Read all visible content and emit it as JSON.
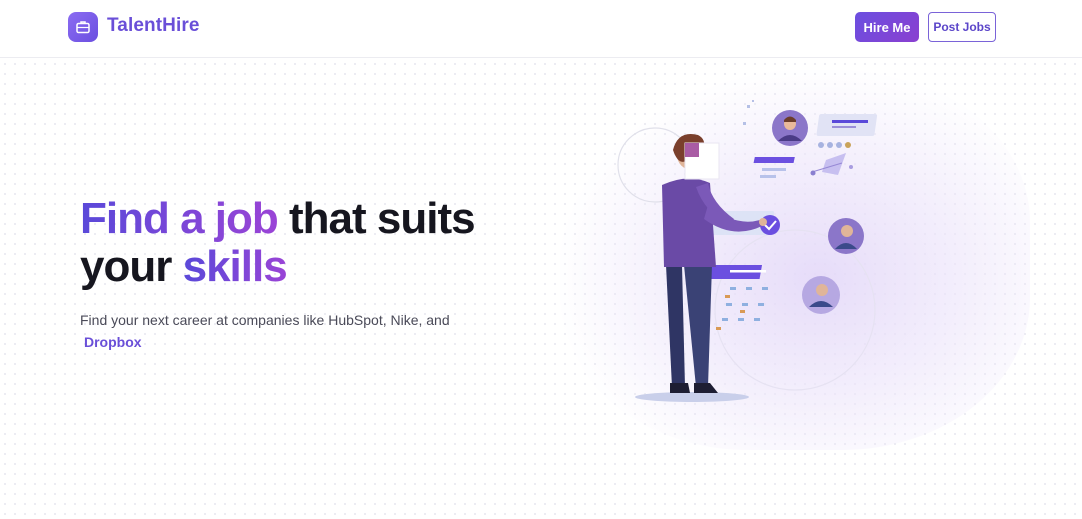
{
  "header": {
    "brand_name": "TalentHire",
    "logo_icon": "briefcase-icon",
    "hire_button_label": "Hire Me",
    "post_button_label": "Post Jobs"
  },
  "hero": {
    "headline": {
      "part1": "Find a job",
      "part2": "that suits",
      "part3": "your",
      "part4": "skills"
    },
    "subtext": "Find your next career at companies like HubSpot, Nike, and",
    "subtext_link": "Dropbox",
    "illustration": "person-selecting-candidate-profiles-illustration"
  },
  "colors": {
    "brand_purple": "#6a4fd8",
    "gradient_start": "#5a49d9",
    "gradient_end": "#9a44d6",
    "text_dark": "#16161f"
  }
}
